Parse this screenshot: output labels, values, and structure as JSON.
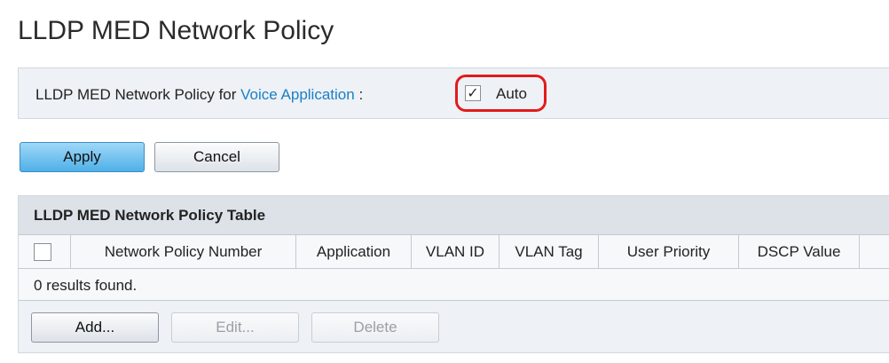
{
  "page": {
    "title": "LLDP MED Network Policy"
  },
  "policy": {
    "label_prefix": "LLDP MED Network Policy for",
    "link": "Voice Application",
    "separator": ":",
    "auto_label": "Auto",
    "auto_checked": true,
    "highlight_color": "#e21b1b"
  },
  "actions": {
    "apply_label": "Apply",
    "cancel_label": "Cancel"
  },
  "table": {
    "title": "LLDP MED Network Policy Table",
    "columns": [
      "Network Policy Number",
      "Application",
      "VLAN ID",
      "VLAN Tag",
      "User Priority",
      "DSCP Value"
    ],
    "results_text": "0 results found.",
    "buttons": {
      "add": "Add...",
      "edit": "Edit...",
      "delete": "Delete"
    }
  },
  "colors": {
    "accent": "#1b7fc7",
    "apply_button": "#4fb0e8"
  }
}
